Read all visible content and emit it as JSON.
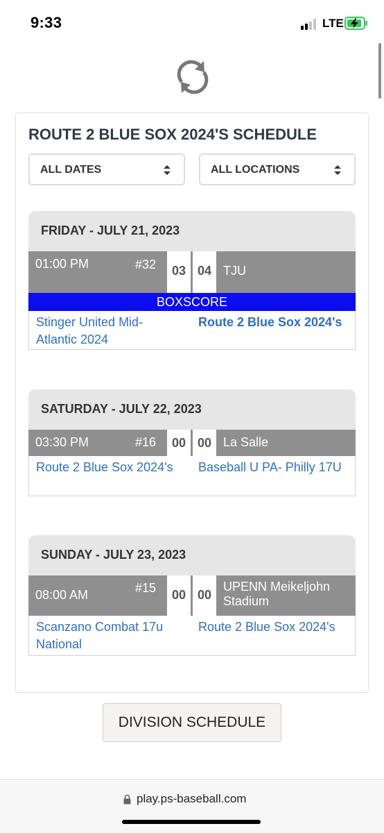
{
  "status_bar": {
    "time": "9:33",
    "network": "LTE",
    "icons": [
      "signal-icon",
      "battery-charging-icon"
    ]
  },
  "refresh": {
    "icon": "refresh-icon"
  },
  "schedule": {
    "title": "ROUTE 2 BLUE SOX 2024'S SCHEDULE",
    "filters": {
      "dates": {
        "selected": "ALL DATES"
      },
      "locations": {
        "selected": "ALL LOCATIONS"
      }
    },
    "days": [
      {
        "header": "FRIDAY - JULY 21, 2023",
        "game": {
          "time": "01:00 PM",
          "number": "#32",
          "score_home": "03",
          "score_away": "04",
          "location": "TJU"
        },
        "boxscore_label": "BOXSCORE",
        "team_a": "Stinger United Mid-Atlantic 2024",
        "team_b": "Route 2 Blue Sox 2024's"
      },
      {
        "header": "SATURDAY - JULY 22, 2023",
        "game": {
          "time": "03:30 PM",
          "number": "#16",
          "score_home": "00",
          "score_away": "00",
          "location": "La Salle"
        },
        "team_a": "Route 2 Blue Sox 2024's",
        "team_b": "Baseball U PA- Philly 17U"
      },
      {
        "header": "SUNDAY - JULY 23, 2023",
        "game": {
          "time": "08:00 AM",
          "number": "#15",
          "score_home": "00",
          "score_away": "00",
          "location": "UPENN Meikeljohn Stadium"
        },
        "team_a": "Scanzano Combat 17u National",
        "team_b": "Route 2 Blue Sox 2024's"
      }
    ]
  },
  "division_button": "DIVISION SCHEDULE",
  "browser": {
    "url": "play.ps-baseball.com"
  },
  "colors": {
    "boxscore_bar": "#0c0cf0",
    "game_row": "#8f8f8f",
    "team_link": "#2f6fc8",
    "day_header": "#e6e6e6"
  }
}
